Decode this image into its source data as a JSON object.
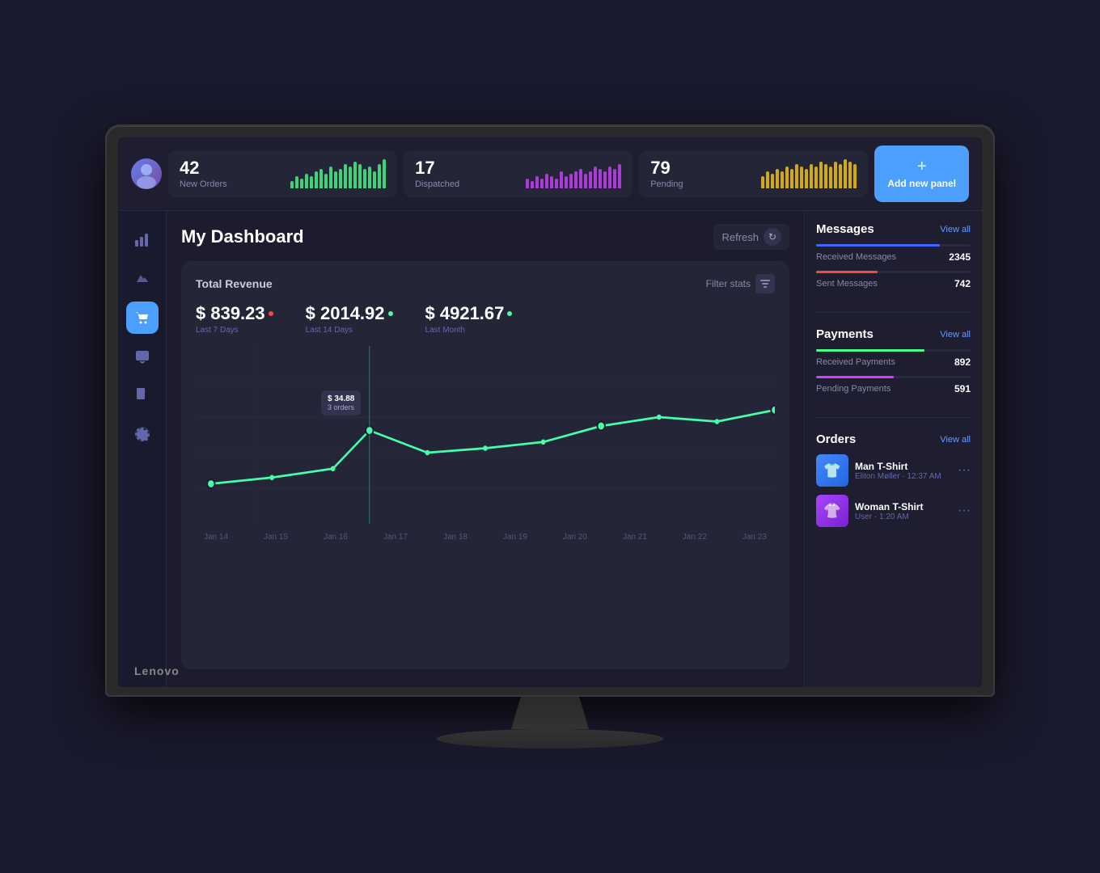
{
  "monitor": {
    "brand": "Lenovo"
  },
  "topbar": {
    "stats": [
      {
        "number": "42",
        "label": "New Orders",
        "chart_color": "#44ff88",
        "bars": [
          3,
          5,
          4,
          6,
          5,
          7,
          8,
          6,
          9,
          7,
          8,
          10,
          9,
          11,
          10,
          8,
          9,
          7,
          10,
          12
        ]
      },
      {
        "number": "17",
        "label": "Dispatched",
        "chart_color": "#cc44ff",
        "bars": [
          4,
          3,
          5,
          4,
          6,
          5,
          4,
          7,
          5,
          6,
          7,
          8,
          6,
          7,
          9,
          8,
          7,
          9,
          8,
          10
        ]
      },
      {
        "number": "79",
        "label": "Pending",
        "chart_color": "#ffcc00",
        "bars": [
          5,
          7,
          6,
          8,
          7,
          9,
          8,
          10,
          9,
          8,
          10,
          9,
          11,
          10,
          9,
          11,
          10,
          12,
          11,
          10
        ]
      }
    ],
    "add_panel_label": "Add new panel"
  },
  "sidebar": {
    "items": [
      {
        "icon": "📊",
        "name": "analytics",
        "active": false
      },
      {
        "icon": "🎨",
        "name": "design",
        "active": false
      },
      {
        "icon": "🛒",
        "name": "orders",
        "active": true
      },
      {
        "icon": "💬",
        "name": "messages",
        "active": false
      },
      {
        "icon": "📄",
        "name": "documents",
        "active": false
      },
      {
        "icon": "⚙️",
        "name": "settings",
        "active": false
      }
    ]
  },
  "dashboard": {
    "title": "My Dashboard",
    "refresh_label": "Refresh",
    "revenue": {
      "title": "Total Revenue",
      "filter_label": "Filter stats",
      "stats": [
        {
          "amount": "$ 839.23",
          "period": "Last 7 Days",
          "dot": "red"
        },
        {
          "amount": "$ 2014.92",
          "period": "Last 14 Days",
          "dot": "green"
        },
        {
          "amount": "$ 4921.67",
          "period": "Last Month",
          "dot": "green"
        }
      ],
      "tooltip": {
        "amount": "$ 34.88",
        "orders": "3 orders"
      },
      "x_labels": [
        "Jan 14",
        "Jan 15",
        "Jan 16",
        "Jan 17",
        "Jan 18",
        "Jan 19",
        "Jan 20",
        "Jan 21",
        "Jan 22",
        "Jan 23"
      ]
    }
  },
  "right_panel": {
    "messages": {
      "title": "Messages",
      "view_all": "View all",
      "items": [
        {
          "label": "Received Messages",
          "count": "2345",
          "color": "#4466ff",
          "fill_pct": 80
        },
        {
          "label": "Sent Messages",
          "count": "742",
          "color": "#ff4444",
          "fill_pct": 40
        }
      ]
    },
    "payments": {
      "title": "Payments",
      "view_all": "View all",
      "items": [
        {
          "label": "Received Payments",
          "count": "892",
          "color": "#44ff88",
          "fill_pct": 70
        },
        {
          "label": "Pending Payments",
          "count": "591",
          "color": "#cc44ff",
          "fill_pct": 50
        }
      ]
    },
    "orders": {
      "title": "Orders",
      "view_all": "View all",
      "items": [
        {
          "name": "Man T-Shirt",
          "meta": "Eliton Møller · 12:37 AM",
          "img_type": "blue-shirt",
          "emoji": "👕"
        },
        {
          "name": "Woman T-Shirt",
          "meta": "User · 1:20 AM",
          "img_type": "purple-shirt",
          "emoji": "👚"
        }
      ]
    }
  }
}
